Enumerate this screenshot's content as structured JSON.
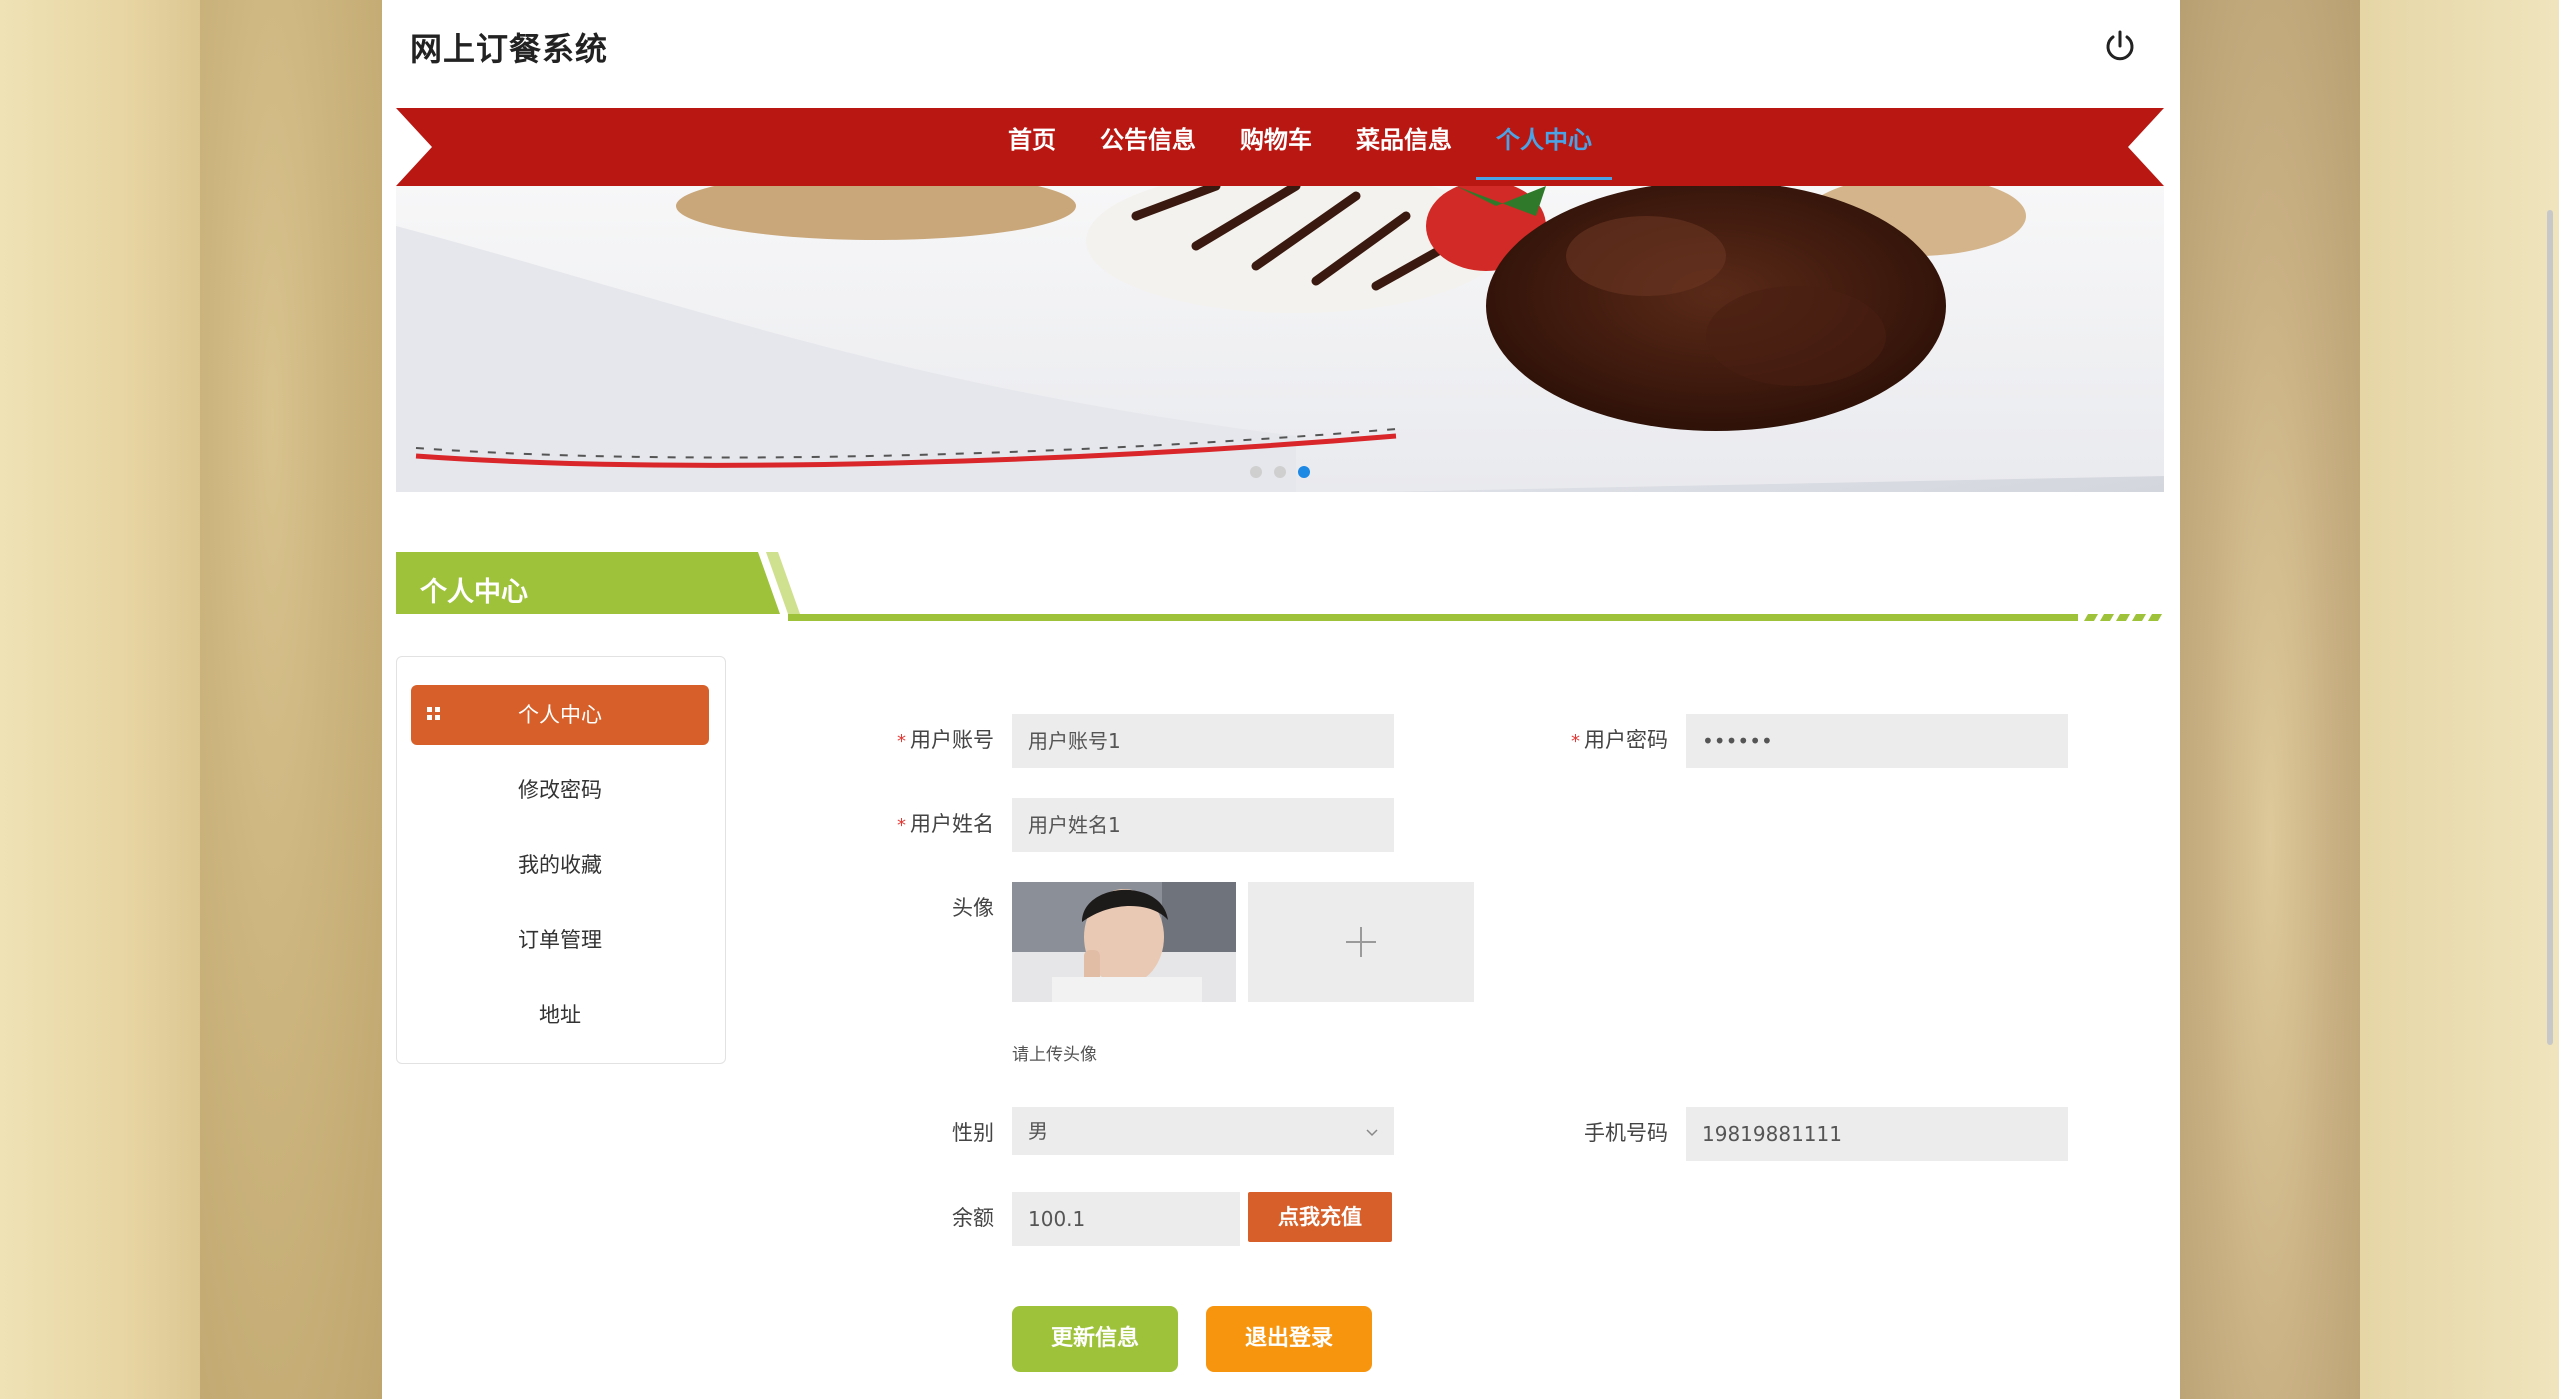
{
  "header": {
    "title": "网上订餐系统"
  },
  "nav": {
    "items": [
      {
        "label": "首页"
      },
      {
        "label": "公告信息"
      },
      {
        "label": "购物车"
      },
      {
        "label": "菜品信息"
      },
      {
        "label": "个人中心"
      }
    ],
    "active_index": 4
  },
  "banner": {
    "slide_count": 3,
    "active_slide": 3
  },
  "section": {
    "title": "个人中心"
  },
  "sidebar": {
    "items": [
      {
        "label": "个人中心"
      },
      {
        "label": "修改密码"
      },
      {
        "label": "我的收藏"
      },
      {
        "label": "订单管理"
      },
      {
        "label": "地址"
      }
    ]
  },
  "form": {
    "required_mark": "*",
    "account": {
      "label": "用户账号",
      "value": "用户账号1"
    },
    "password": {
      "label": "用户密码",
      "value": "••••••"
    },
    "name": {
      "label": "用户姓名",
      "value": "用户姓名1"
    },
    "avatar": {
      "label": "头像",
      "hint": "请上传头像"
    },
    "gender": {
      "label": "性别",
      "value": "男"
    },
    "phone": {
      "label": "手机号码",
      "value": "19819881111"
    },
    "balance": {
      "label": "余额",
      "value": "100.1",
      "recharge_label": "点我充值"
    },
    "update_label": "更新信息",
    "logout_label": "退出登录"
  },
  "colors": {
    "nav_red": "#b81712",
    "section_green": "#9ec23a",
    "accent_orange": "#d7602a",
    "logout_orange": "#f7950f",
    "active_blue": "#4aa3e6"
  }
}
